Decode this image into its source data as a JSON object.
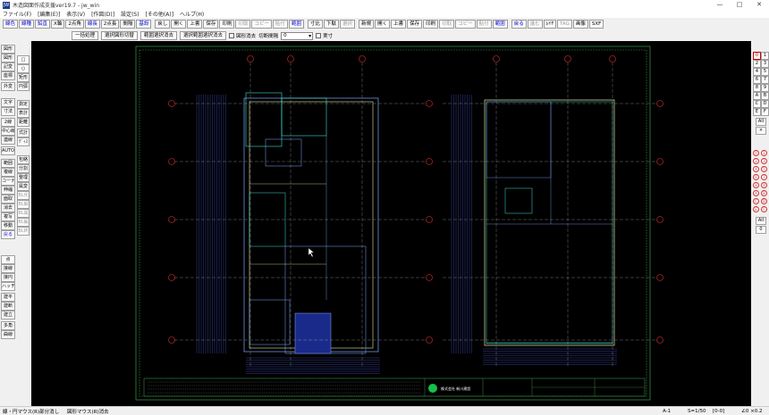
{
  "window": {
    "title": "木造図面作成支援ver19.7 - jw_win",
    "minimize": "—",
    "maximize": "□",
    "close": "✕"
  },
  "menu": [
    "ファイル(F)",
    "[編集(E)]",
    "表示(V)",
    "[作図(D)]",
    "設定(S)",
    "[その他(A)]",
    "ヘルプ(H)"
  ],
  "toolbar1": [
    {
      "label": "線色",
      "state": "hl"
    },
    {
      "label": "線種",
      "state": "hl"
    },
    {
      "label": "鉛直",
      "state": "hl"
    },
    {
      "label": "X軸",
      "state": "normal"
    },
    {
      "label": "2点角",
      "state": "normal"
    },
    {
      "label": "線長",
      "state": "hl"
    },
    {
      "label": "2点長",
      "state": "normal"
    },
    {
      "label": "間隔",
      "state": "normal"
    },
    {
      "label": "基設",
      "state": "hl",
      "gap": true
    },
    {
      "label": "戻し",
      "state": "normal"
    },
    {
      "label": "開く",
      "state": "normal"
    },
    {
      "label": "上書",
      "state": "normal"
    },
    {
      "label": "保存",
      "state": "normal"
    },
    {
      "label": "印刷",
      "state": "normal"
    },
    {
      "label": "切取",
      "state": "gray"
    },
    {
      "label": "コピー",
      "state": "gray"
    },
    {
      "label": "貼付",
      "state": "gray"
    },
    {
      "label": "範囲",
      "state": "hl",
      "gap": true
    },
    {
      "label": "寸比",
      "state": "normal"
    },
    {
      "label": "下駄",
      "state": "normal"
    },
    {
      "label": "選択",
      "state": "gray",
      "gap": true
    },
    {
      "label": "新規",
      "state": "normal"
    },
    {
      "label": "開く",
      "state": "normal"
    },
    {
      "label": "上書",
      "state": "normal"
    },
    {
      "label": "保存",
      "state": "normal"
    },
    {
      "label": "印刷",
      "state": "normal"
    },
    {
      "label": "切取",
      "state": "gray"
    },
    {
      "label": "コピー",
      "state": "gray"
    },
    {
      "label": "貼付",
      "state": "gray"
    },
    {
      "label": "範囲",
      "state": "hl",
      "gap": true
    },
    {
      "label": "戻る",
      "state": "hl"
    },
    {
      "label": "進む",
      "state": "gray"
    },
    {
      "label": "ﾚｲﾔ",
      "state": "normal"
    },
    {
      "label": "TAG",
      "state": "gray"
    },
    {
      "label": "画像",
      "state": "normal"
    },
    {
      "label": "SXF",
      "state": "normal"
    }
  ],
  "toolbar2": {
    "bulk": "一括処理",
    "select_all": "選択図形切替",
    "select_range": "範囲選択消去",
    "deselect": "選択範囲選択消去",
    "check1": "図形消去",
    "cut_spacing_label": "切断間隔",
    "cut_spacing_value": "0",
    "check2": "実寸"
  },
  "left_tools": [
    "図形",
    "図形",
    "記変",
    "座標",
    "外変",
    "文字",
    "寸法",
    "2線",
    "中心線",
    "連線",
    "AUTO",
    "範囲",
    "複線",
    "コーナー",
    "伸縮",
    "面取",
    "消去",
    "複写",
    "移動",
    "戻る",
    "点",
    "接線",
    "接円",
    "ハッチ",
    "建平",
    "建断",
    "建立",
    "多角",
    "曲線"
  ],
  "left_tools2": [
    "□",
    "○",
    "矩形",
    "円弧",
    "測定",
    "表計",
    "距離",
    "式計",
    "ﾃﾞｨｽ",
    "包絡",
    "分割",
    "整理",
    "属変",
    "BL化",
    "BL解",
    "BL属",
    "BL編",
    "BL終"
  ],
  "right_layers": [
    "0",
    "1",
    "2",
    "3",
    "4",
    "5",
    "6",
    "7",
    "8",
    "9",
    "A",
    "B",
    "C",
    "D",
    "E",
    "F"
  ],
  "right_all": "All",
  "right_x": "×",
  "right_groups": [
    "0",
    "1",
    "2",
    "3",
    "4",
    "5",
    "6",
    "7",
    "8",
    "9",
    "A",
    "B",
    "C",
    "D",
    "E",
    "F"
  ],
  "right_all2": "All",
  "right_zero": "0",
  "drawing": {
    "company": "株式会社 新川建設"
  },
  "status": {
    "left": "線・円マウス(R)部分消し",
    "mid": "図形マウス(R)消去",
    "paper": "A-1",
    "scale": "S=1/50",
    "layer": "[0-0]",
    "angle": "∠0",
    "zoom": "×0.2"
  }
}
